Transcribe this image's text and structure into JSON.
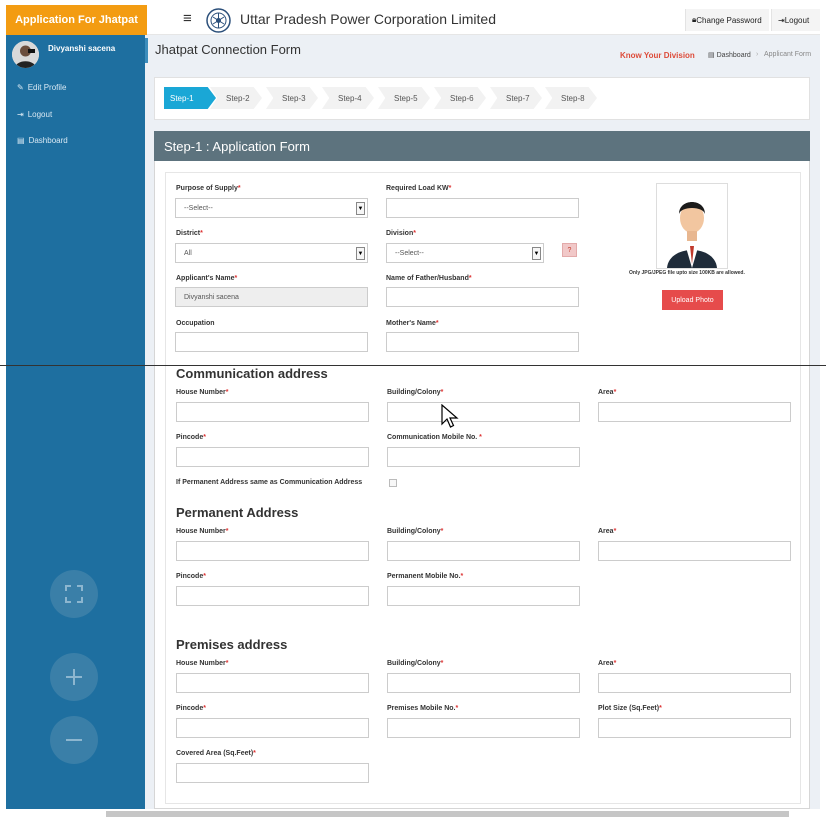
{
  "app": {
    "brand": "Application For Jhatpat",
    "menu_icon": "≡",
    "title": "Uttar Pradesh Power Corporation Limited",
    "change_password": "Change Password",
    "logout": "Logout"
  },
  "sidebar": {
    "user_name": "Divyanshi sacena",
    "items": [
      {
        "label": "Edit Profile",
        "icon": "edit-icon"
      },
      {
        "label": "Logout",
        "icon": "logout-icon"
      },
      {
        "label": "Dashboard",
        "icon": "dashboard-icon"
      }
    ]
  },
  "header": {
    "title": "Jhatpat Connection Form",
    "know_division": "Know Your Division",
    "breadcrumb_dashboard": "Dashboard",
    "breadcrumb_sep": "›",
    "breadcrumb_current": "Applicant Form"
  },
  "steps": [
    "Step-1",
    "Step-2",
    "Step-3",
    "Step-4",
    "Step-5",
    "Step-6",
    "Step-7",
    "Step-8"
  ],
  "form": {
    "title": "Step-1 : Application Form",
    "purpose_label": "Purpose of Supply",
    "purpose_value": "--Select--",
    "load_label": "Required Load KW",
    "district_label": "District",
    "district_value": "All",
    "division_label": "Division",
    "division_value": "--Select--",
    "help": "?",
    "applicant_label": "Applicant's Name",
    "applicant_value": "Divyanshi sacena",
    "father_label": "Name of Father/Husband",
    "occupation_label": "Occupation",
    "mother_label": "Mother's Name",
    "photo_note": "Only JPG/JPEG file upto size 100KB are allowed.",
    "upload_button": "Upload Photo",
    "comm_title": "Communication address",
    "house_label": "House Number",
    "building_label": "Building/Colony",
    "area_label": "Area",
    "pincode_label": "Pincode",
    "comm_mobile_label": "Communication Mobile No. ",
    "same_address_label": "If Permanent Address same as Communication Address",
    "perm_title": "Permanent Address",
    "perm_mobile_label": "Permanent Mobile No.",
    "prem_title": "Premises address",
    "prem_mobile_label": "Premises Mobile No.",
    "plot_label": "Plot Size (Sq.Feet)",
    "covered_label": "Covered Area (Sq.Feet)",
    "required_mark": "*"
  },
  "colors": {
    "brand": "#f39c12",
    "sidebar": "#1e6fa0",
    "step_active": "#1aa7d6",
    "panel_header": "#5d737e",
    "upload": "#e64b4b"
  }
}
